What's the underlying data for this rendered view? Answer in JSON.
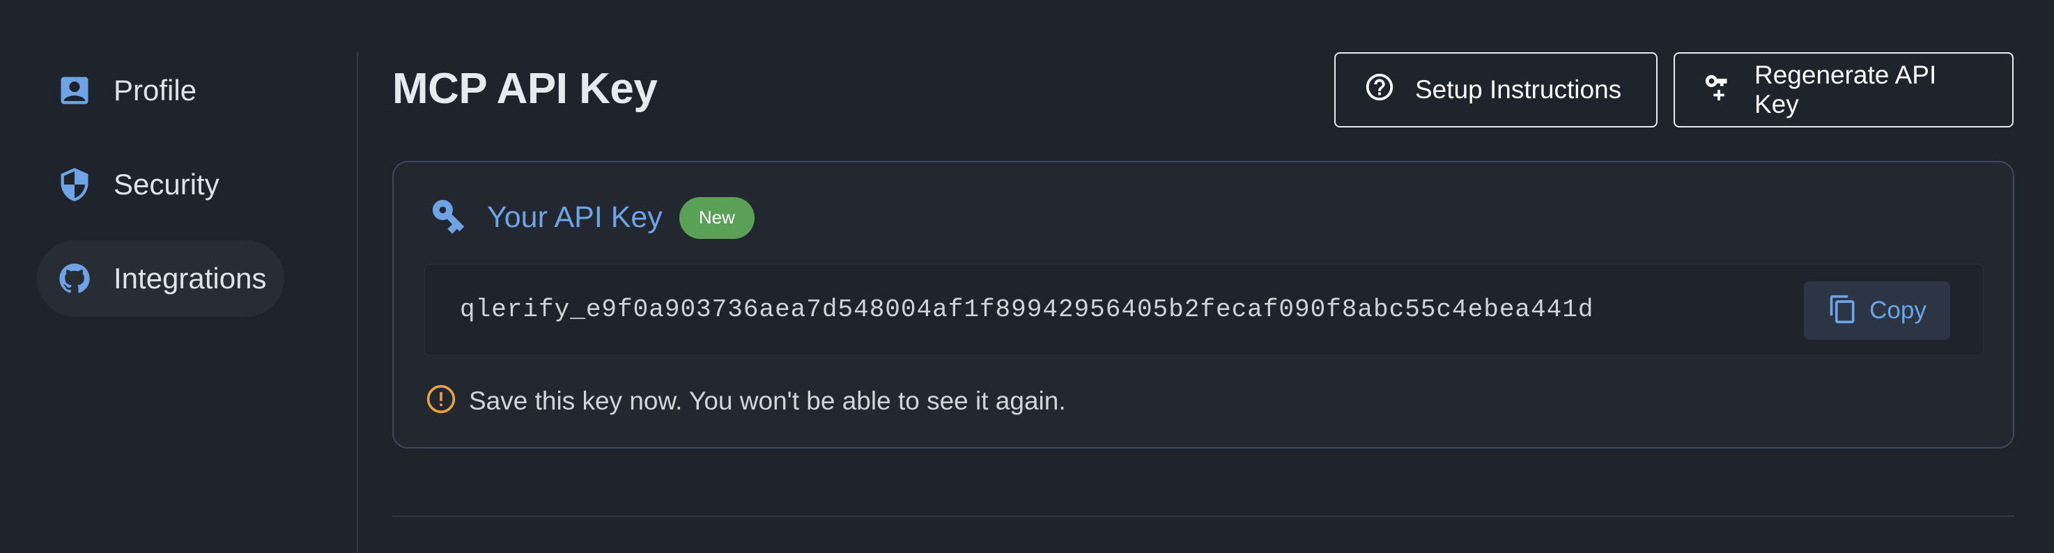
{
  "sidebar": {
    "items": [
      {
        "label": "Profile",
        "icon": "account-box-icon",
        "active": false
      },
      {
        "label": "Security",
        "icon": "shield-icon",
        "active": false
      },
      {
        "label": "Integrations",
        "icon": "github-icon",
        "active": true
      }
    ]
  },
  "header": {
    "title": "MCP API Key",
    "setup_label": "Setup Instructions",
    "setup_icon": "help-circle-icon",
    "regenerate_label": "Regenerate API Key",
    "regenerate_icon": "key-plus-icon"
  },
  "api_key_card": {
    "title": "Your API Key",
    "title_icon": "key-icon",
    "badge": "New",
    "key_value": "qlerify_e9f0a903736aea7d548004af1f89942956405b2fecaf090f8abc55c4ebea441d",
    "copy_label": "Copy",
    "copy_icon": "copy-icon",
    "warning_text": "Save this key now. You won't be able to see it again.",
    "warning_icon": "alert-circle-icon"
  },
  "colors": {
    "background": "#1f232b",
    "accent": "#6ea3e6",
    "badge_green": "#5aa157",
    "warning_orange": "#e8a33c"
  }
}
